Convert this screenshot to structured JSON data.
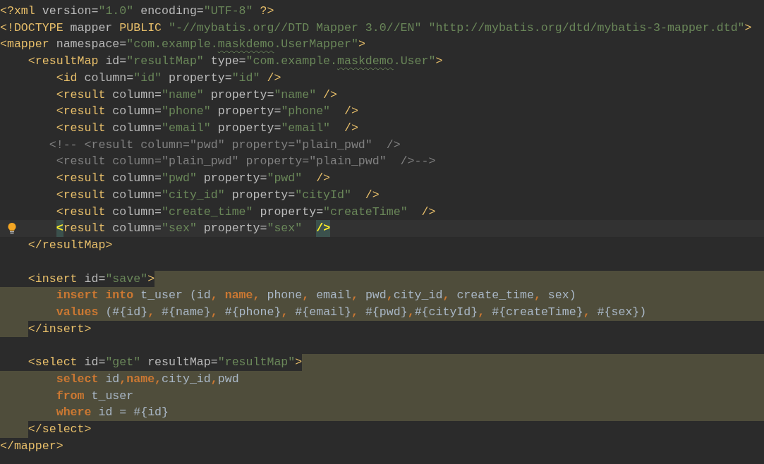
{
  "editor": {
    "lines": [
      {
        "current": false,
        "kind": "plain",
        "tokens": [
          {
            "kind": "tag",
            "t": "<?xml"
          },
          {
            "kind": "attr",
            "t": " version="
          },
          {
            "kind": "str",
            "t": "\"1.0\""
          },
          {
            "kind": "attr",
            "t": " encoding="
          },
          {
            "kind": "str",
            "t": "\"UTF-8\""
          },
          {
            "kind": "tag",
            "t": " ?>"
          }
        ]
      },
      {
        "current": false,
        "kind": "plain",
        "tokens": [
          {
            "kind": "tag",
            "t": "<!DOCTYPE"
          },
          {
            "kind": "attr",
            "t": " mapper "
          },
          {
            "kind": "tag",
            "t": "PUBLIC"
          },
          {
            "kind": "str",
            "t": " \"-//mybatis.org//DTD Mapper 3.0//EN\" \"http://mybatis.org/dtd/mybatis-3-mapper.dtd\""
          },
          {
            "kind": "tag",
            "t": ">"
          }
        ]
      },
      {
        "current": false,
        "kind": "plain",
        "tokens": [
          {
            "kind": "tag",
            "t": "<mapper"
          },
          {
            "kind": "attr",
            "t": " namespace="
          },
          {
            "kind": "str",
            "t": "\"com.example."
          },
          {
            "kind": "typo",
            "t": "maskdemo"
          },
          {
            "kind": "str",
            "t": ".UserMapper\""
          },
          {
            "kind": "tag",
            "t": ">"
          }
        ]
      },
      {
        "current": false,
        "kind": "plain",
        "tokens": [
          {
            "kind": "tag",
            "t": "    <resultMap"
          },
          {
            "kind": "attr",
            "t": " id="
          },
          {
            "kind": "str",
            "t": "\"resultMap\""
          },
          {
            "kind": "attr",
            "t": " type="
          },
          {
            "kind": "str",
            "t": "\"com.example."
          },
          {
            "kind": "typo",
            "t": "maskdemo"
          },
          {
            "kind": "str",
            "t": ".User\""
          },
          {
            "kind": "tag",
            "t": ">"
          }
        ]
      },
      {
        "current": false,
        "kind": "plain",
        "tokens": [
          {
            "kind": "tag",
            "t": "        <id"
          },
          {
            "kind": "attr",
            "t": " column="
          },
          {
            "kind": "str",
            "t": "\"id\""
          },
          {
            "kind": "attr",
            "t": " property="
          },
          {
            "kind": "str",
            "t": "\"id\""
          },
          {
            "kind": "tag",
            "t": " />"
          }
        ]
      },
      {
        "current": false,
        "kind": "plain",
        "tokens": [
          {
            "kind": "tag",
            "t": "        <result"
          },
          {
            "kind": "attr",
            "t": " column="
          },
          {
            "kind": "str",
            "t": "\"name\""
          },
          {
            "kind": "attr",
            "t": " property="
          },
          {
            "kind": "str",
            "t": "\"name\""
          },
          {
            "kind": "tag",
            "t": " />"
          }
        ]
      },
      {
        "current": false,
        "kind": "plain",
        "tokens": [
          {
            "kind": "tag",
            "t": "        <result"
          },
          {
            "kind": "attr",
            "t": " column="
          },
          {
            "kind": "str",
            "t": "\"phone\""
          },
          {
            "kind": "attr",
            "t": " property="
          },
          {
            "kind": "str",
            "t": "\"phone\""
          },
          {
            "kind": "tag",
            "t": "  />"
          }
        ]
      },
      {
        "current": false,
        "kind": "plain",
        "tokens": [
          {
            "kind": "tag",
            "t": "        <result"
          },
          {
            "kind": "attr",
            "t": " column="
          },
          {
            "kind": "str",
            "t": "\"email\""
          },
          {
            "kind": "attr",
            "t": " property="
          },
          {
            "kind": "str",
            "t": "\"email\""
          },
          {
            "kind": "tag",
            "t": "  />"
          }
        ]
      },
      {
        "current": false,
        "kind": "plain",
        "tokens": [
          {
            "kind": "cmt",
            "t": "       <!-- <result column=\"pwd\" property=\"plain_pwd\"  />"
          }
        ]
      },
      {
        "current": false,
        "kind": "plain",
        "tokens": [
          {
            "kind": "cmt",
            "t": "        <result column=\"plain_pwd\" property=\"plain_pwd\"  />-->"
          }
        ]
      },
      {
        "current": false,
        "kind": "plain",
        "tokens": [
          {
            "kind": "tag",
            "t": "        <result"
          },
          {
            "kind": "attr",
            "t": " column="
          },
          {
            "kind": "str",
            "t": "\"pwd\""
          },
          {
            "kind": "attr",
            "t": " property="
          },
          {
            "kind": "str",
            "t": "\"pwd\""
          },
          {
            "kind": "tag",
            "t": "  />"
          }
        ]
      },
      {
        "current": false,
        "kind": "plain",
        "tokens": [
          {
            "kind": "tag",
            "t": "        <result"
          },
          {
            "kind": "attr",
            "t": " column="
          },
          {
            "kind": "str",
            "t": "\"city_id\""
          },
          {
            "kind": "attr",
            "t": " property="
          },
          {
            "kind": "str",
            "t": "\"cityId\""
          },
          {
            "kind": "tag",
            "t": "  />"
          }
        ]
      },
      {
        "current": false,
        "kind": "plain",
        "tokens": [
          {
            "kind": "tag",
            "t": "        <result"
          },
          {
            "kind": "attr",
            "t": " column="
          },
          {
            "kind": "str",
            "t": "\"create_time\""
          },
          {
            "kind": "attr",
            "t": " property="
          },
          {
            "kind": "str",
            "t": "\"createTime\""
          },
          {
            "kind": "tag",
            "t": "  />"
          }
        ]
      },
      {
        "current": true,
        "kind": "plain",
        "tokens": [
          {
            "kind": "match",
            "t": "        <"
          },
          {
            "kind": "tag",
            "t": "result"
          },
          {
            "kind": "attr",
            "t": " column="
          },
          {
            "kind": "str",
            "t": "\"sex\""
          },
          {
            "kind": "attr",
            "t": " property="
          },
          {
            "kind": "str",
            "t": "\"sex\"  "
          },
          {
            "kind": "match",
            "t": "/>"
          }
        ]
      },
      {
        "current": false,
        "kind": "plain",
        "tokens": [
          {
            "kind": "tag",
            "t": "    </resultMap>"
          }
        ]
      },
      {
        "kind": "blank"
      },
      {
        "current": false,
        "kind": "fragment_tail",
        "tokens": [
          {
            "kind": "tag",
            "t": "    <insert"
          },
          {
            "kind": "attr",
            "t": " id="
          },
          {
            "kind": "str",
            "t": "\"save\""
          },
          {
            "kind": "tag",
            "t": ">"
          }
        ]
      },
      {
        "current": false,
        "kind": "fragment",
        "tokens": [
          {
            "kind": "kw",
            "t": "        insert into"
          },
          {
            "kind": "txt",
            "t": " t_user (id"
          },
          {
            "kind": "kw",
            "t": ", name,"
          },
          {
            "kind": "txt",
            "t": " phone"
          },
          {
            "kind": "kw",
            "t": ","
          },
          {
            "kind": "txt",
            "t": " email"
          },
          {
            "kind": "kw",
            "t": ","
          },
          {
            "kind": "txt",
            "t": " pwd"
          },
          {
            "kind": "kw",
            "t": ","
          },
          {
            "kind": "txt",
            "t": "city_id"
          },
          {
            "kind": "kw",
            "t": ","
          },
          {
            "kind": "txt",
            "t": " create_time"
          },
          {
            "kind": "kw",
            "t": ","
          },
          {
            "kind": "txt",
            "t": " sex)"
          }
        ]
      },
      {
        "current": false,
        "kind": "fragment",
        "tokens": [
          {
            "kind": "kw",
            "t": "        values"
          },
          {
            "kind": "txt",
            "t": " (#{id}"
          },
          {
            "kind": "kw",
            "t": ","
          },
          {
            "kind": "txt",
            "t": " #{name}"
          },
          {
            "kind": "kw",
            "t": ","
          },
          {
            "kind": "txt",
            "t": " #{phone}"
          },
          {
            "kind": "kw",
            "t": ","
          },
          {
            "kind": "txt",
            "t": " #{email}"
          },
          {
            "kind": "kw",
            "t": ","
          },
          {
            "kind": "txt",
            "t": " #{pwd}"
          },
          {
            "kind": "kw",
            "t": ","
          },
          {
            "kind": "txt",
            "t": "#{cityId}"
          },
          {
            "kind": "kw",
            "t": ","
          },
          {
            "kind": "txt",
            "t": " #{createTime}"
          },
          {
            "kind": "kw",
            "t": ","
          },
          {
            "kind": "txt",
            "t": " #{sex})"
          }
        ]
      },
      {
        "current": false,
        "kind": "fragment_indent",
        "tokens": [
          {
            "kind": "tag",
            "t": "    </insert>"
          }
        ]
      },
      {
        "kind": "blank"
      },
      {
        "current": false,
        "kind": "fragment_tail",
        "tokens": [
          {
            "kind": "tag",
            "t": "    <select"
          },
          {
            "kind": "attr",
            "t": " id="
          },
          {
            "kind": "str",
            "t": "\"get\""
          },
          {
            "kind": "attr",
            "t": " resultMap="
          },
          {
            "kind": "str",
            "t": "\"resultMap\""
          },
          {
            "kind": "tag",
            "t": ">"
          }
        ]
      },
      {
        "current": false,
        "kind": "fragment",
        "tokens": [
          {
            "kind": "kw",
            "t": "        select"
          },
          {
            "kind": "txt",
            "t": " id"
          },
          {
            "kind": "kw",
            "t": ",name,"
          },
          {
            "kind": "txt",
            "t": "city_id"
          },
          {
            "kind": "kw",
            "t": ","
          },
          {
            "kind": "txt",
            "t": "pwd"
          }
        ]
      },
      {
        "current": false,
        "kind": "fragment",
        "tokens": [
          {
            "kind": "kw",
            "t": "        from"
          },
          {
            "kind": "txt",
            "t": " t_user"
          }
        ]
      },
      {
        "current": false,
        "kind": "fragment",
        "tokens": [
          {
            "kind": "kw",
            "t": "        where"
          },
          {
            "kind": "txt",
            "t": " id = #{id}"
          }
        ]
      },
      {
        "current": false,
        "kind": "fragment_indent",
        "tokens": [
          {
            "kind": "tag",
            "t": "    </select>"
          }
        ]
      },
      {
        "current": false,
        "kind": "plain",
        "tokens": [
          {
            "kind": "tag",
            "t": "</mapper>"
          }
        ]
      }
    ]
  }
}
